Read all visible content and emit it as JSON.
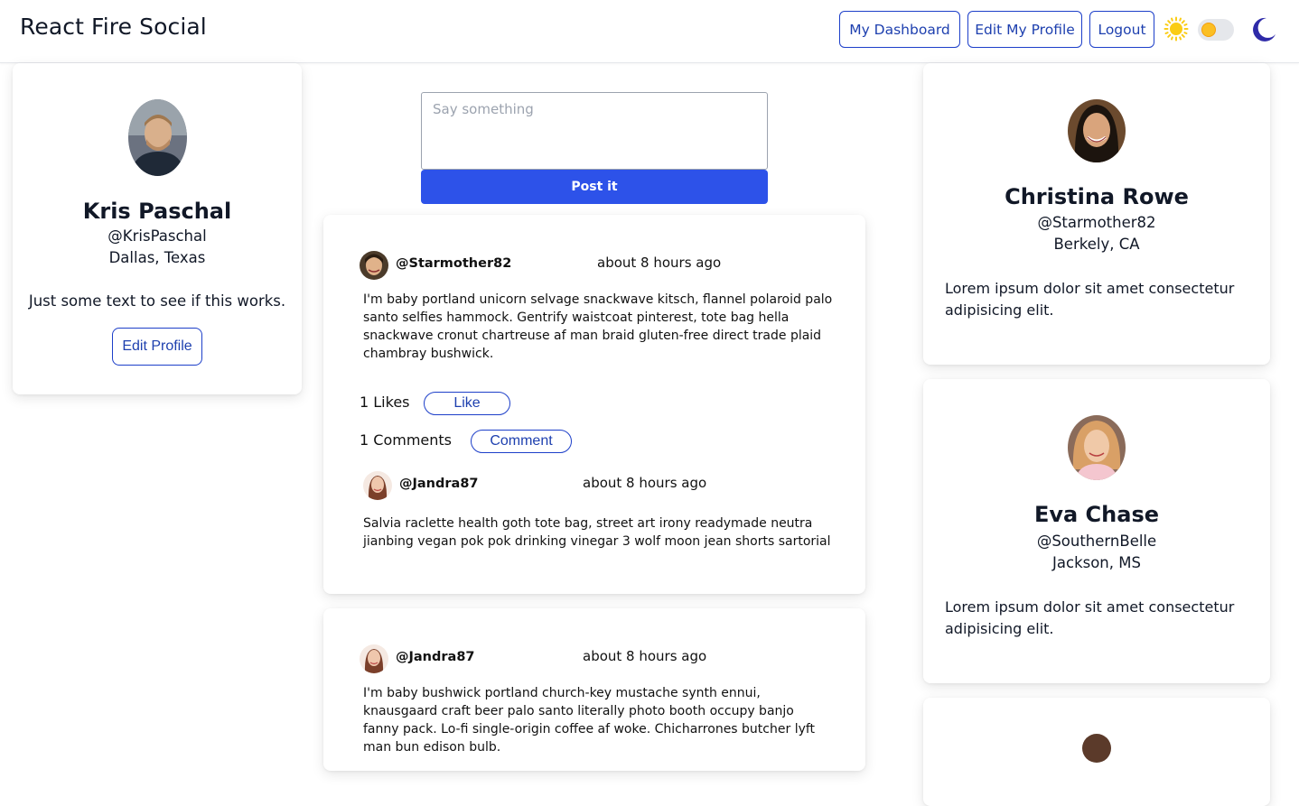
{
  "app": {
    "title": "React Fire Social"
  },
  "nav": {
    "dashboard": "My Dashboard",
    "edit_profile": "Edit My Profile",
    "logout": "Logout"
  },
  "theme": {
    "light_icon": "sun-icon",
    "dark_icon": "moon-icon",
    "mode": "light",
    "accent": "#2d52e9"
  },
  "profile": {
    "name": "Kris Paschal",
    "handle": "@KrisPaschal",
    "location": "Dallas, Texas",
    "bio": "Just some text to see if this works.",
    "edit_label": "Edit Profile"
  },
  "composer": {
    "placeholder": "Say something",
    "post_label": "Post it"
  },
  "posts": [
    {
      "handle": "@Starmother82",
      "time": "about 8 hours ago",
      "text": "I'm baby portland unicorn selvage snackwave kitsch, flannel polaroid palo santo selfies hammock. Gentrify waistcoat pinterest, tote bag hella snackwave cronut chartreuse af man braid gluten-free direct trade plaid chambray bushwick.",
      "likes": "1 Likes",
      "like_label": "Like",
      "comments_count": "1 Comments",
      "comment_label": "Comment",
      "comments": [
        {
          "handle": "@Jandra87",
          "time": "about 8 hours ago",
          "text": "Salvia raclette health goth tote bag, street art irony readymade neutra jianbing vegan pok pok drinking vinegar 3 wolf moon jean shorts sartorial"
        }
      ]
    },
    {
      "handle": "@Jandra87",
      "time": "about 8 hours ago",
      "text": "I'm baby bushwick portland church-key mustache synth ennui, knausgaard craft beer palo santo literally photo booth occupy banjo fanny pack. Lo-fi single-origin coffee af woke. Chicharrones butcher lyft man bun edison bulb."
    }
  ],
  "users": [
    {
      "name": "Christina Rowe",
      "handle": "@Starmother82",
      "location": "Berkely, CA",
      "bio": "Lorem ipsum dolor sit amet consectetur adipisicing elit."
    },
    {
      "name": "Eva Chase",
      "handle": "@SouthernBelle",
      "location": "Jackson, MS",
      "bio": "Lorem ipsum dolor sit amet consectetur adipisicing elit."
    }
  ]
}
